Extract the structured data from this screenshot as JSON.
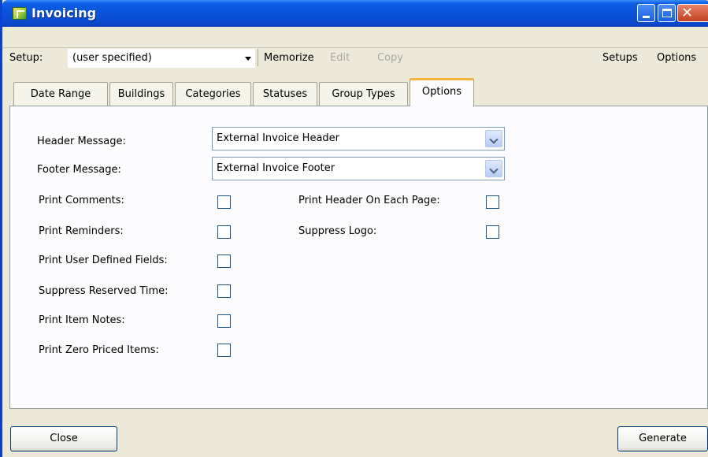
{
  "window": {
    "title": "Invoicing"
  },
  "setup": {
    "label": "Setup:",
    "value": "(user specified)",
    "memorize": "Memorize",
    "edit": "Edit",
    "copy": "Copy",
    "setups": "Setups",
    "options": "Options"
  },
  "tabs": [
    {
      "label": "Date Range"
    },
    {
      "label": "Buildings"
    },
    {
      "label": "Categories"
    },
    {
      "label": "Statuses"
    },
    {
      "label": "Group Types"
    },
    {
      "label": "Options",
      "active": true
    }
  ],
  "form": {
    "header_message": {
      "label": "Header Message:",
      "value": "External Invoice Header"
    },
    "footer_message": {
      "label": "Footer Message:",
      "value": "External Invoice Footer"
    },
    "print_comments": {
      "label": "Print Comments:",
      "checked": false
    },
    "print_reminders": {
      "label": "Print Reminders:",
      "checked": false
    },
    "print_user_defined_fields": {
      "label": "Print User Defined Fields:",
      "checked": false
    },
    "suppress_reserved_time": {
      "label": "Suppress Reserved Time:",
      "checked": false
    },
    "print_item_notes": {
      "label": "Print Item Notes:",
      "checked": false
    },
    "print_zero_priced_items": {
      "label": "Print Zero Priced Items:",
      "checked": false
    },
    "print_header_each_page": {
      "label": "Print Header On Each Page:",
      "checked": false
    },
    "suppress_logo": {
      "label": "Suppress Logo:",
      "checked": false
    }
  },
  "buttons": {
    "close": "Close",
    "generate": "Generate"
  }
}
